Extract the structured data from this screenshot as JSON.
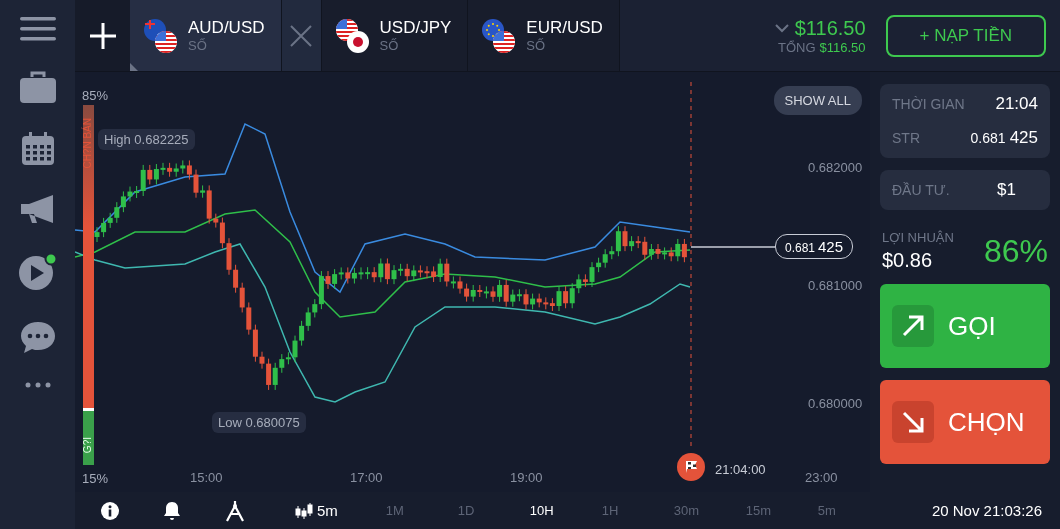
{
  "tabs": [
    {
      "symbol": "AUD/USD",
      "subtitle": "SỐ",
      "selected": true
    },
    {
      "symbol": "USD/JPY",
      "subtitle": "SỐ",
      "selected": false
    },
    {
      "symbol": "EUR/USD",
      "subtitle": "SỐ",
      "selected": false
    }
  ],
  "balance": {
    "amount": "$116.50",
    "total_label": "TỔNG",
    "total_value": "$116.50"
  },
  "deposit_button": "+ NẠP TIỀN",
  "chart": {
    "show_all": "SHOW ALL",
    "high": "High 0.682225",
    "low": "Low 0.680075",
    "y_labels": [
      "0.682000",
      "0.681000",
      "0.680000"
    ],
    "x_labels": [
      "15:00",
      "17:00",
      "19:00",
      "23:00"
    ],
    "price_main": "0.681",
    "price_tail": "425",
    "expiry_time": "21:04:00",
    "sentiment": {
      "top_label": "85%",
      "bottom_label": "15%",
      "sell_label": "CH?N BÁN",
      "buy_label": "G?I",
      "level": 0.85
    }
  },
  "panel": {
    "time_label": "THỜI GIAN",
    "time_value": "21:04",
    "strike_label": "STR",
    "strike_main": "0.681",
    "strike_tail": "425",
    "invest_label": "ĐẦU TƯ.",
    "invest_value": "$1",
    "profit_label": "LỢI NHUẬN",
    "profit_value": "$0.86",
    "profit_percent": "86%",
    "call_button": "GỌI",
    "put_button": "CHỌN"
  },
  "bottom_bar": {
    "chart_type_label": "5m",
    "periods": [
      {
        "label": "1M",
        "selected": false
      },
      {
        "label": "1D",
        "selected": false
      },
      {
        "label": "10H",
        "selected": true
      },
      {
        "label": "1H",
        "selected": false
      },
      {
        "label": "30m",
        "selected": false
      },
      {
        "label": "15m",
        "selected": false
      },
      {
        "label": "5m",
        "selected": false
      }
    ],
    "datetime": "20 Nov 21:03:26"
  }
}
